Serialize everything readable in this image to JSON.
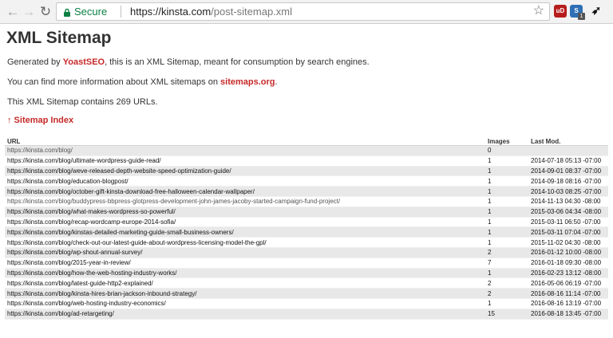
{
  "browser": {
    "secure_label": "Secure",
    "url_host": "https://kinsta.com",
    "url_path": "/post-sitemap.xml",
    "extension_badge": "1",
    "ublock_label": "uD"
  },
  "page": {
    "title": "XML Sitemap",
    "intro_prefix": "Generated by ",
    "intro_link": "YoastSEO",
    "intro_suffix": ", this is an XML Sitemap, meant for consumption by search engines.",
    "more_prefix": "You can find more information about XML sitemaps on ",
    "more_link": "sitemaps.org",
    "more_suffix": ".",
    "count_text": "This XML Sitemap contains 269 URLs.",
    "index_link": "↑ Sitemap Index"
  },
  "table": {
    "headers": [
      "URL",
      "Images",
      "Last Mod."
    ],
    "rows": [
      [
        "https://kinsta.com/blog/",
        "0",
        ""
      ],
      [
        "https://kinsta.com/blog/ultimate-wordpress-guide-read/",
        "1",
        "2014-07-18 05:13 -07:00"
      ],
      [
        "https://kinsta.com/blog/weve-released-depth-website-speed-optimization-guide/",
        "1",
        "2014-09-01 08:37 -07:00"
      ],
      [
        "https://kinsta.com/blog/education-blogpost/",
        "1",
        "2014-09-18 08:16 -07:00"
      ],
      [
        "https://kinsta.com/blog/october-gift-kinsta-download-free-halloween-calendar-wallpaper/",
        "1",
        "2014-10-03 08:25 -07:00"
      ],
      [
        "https://kinsta.com/blog/buddypress-bbpress-glotpress-development-john-james-jacoby-started-campaign-fund-project/",
        "1",
        "2014-11-13 04:30 -08:00"
      ],
      [
        "https://kinsta.com/blog/what-makes-wordpress-so-powerful/",
        "1",
        "2015-03-06 04:34 -08:00"
      ],
      [
        "https://kinsta.com/blog/recap-wordcamp-europe-2014-sofia/",
        "1",
        "2015-03-11 06:50 -07:00"
      ],
      [
        "https://kinsta.com/blog/kinstas-detailed-marketing-guide-small-business-owners/",
        "1",
        "2015-03-11 07:04 -07:00"
      ],
      [
        "https://kinsta.com/blog/check-out-our-latest-guide-about-wordpress-licensing-model-the-gpl/",
        "1",
        "2015-11-02 04:30 -08:00"
      ],
      [
        "https://kinsta.com/blog/wp-shout-annual-survey/",
        "2",
        "2016-01-12 10:00 -08:00"
      ],
      [
        "https://kinsta.com/blog/2015-year-in-review/",
        "7",
        "2016-01-18 09:30 -08:00"
      ],
      [
        "https://kinsta.com/blog/how-the-web-hosting-industry-works/",
        "1",
        "2016-02-23 13:12 -08:00"
      ],
      [
        "https://kinsta.com/blog/latest-guide-http2-explained/",
        "2",
        "2016-05-06 06:19 -07:00"
      ],
      [
        "https://kinsta.com/blog/kinsta-hires-brian-jackson-inbound-strategy/",
        "2",
        "2016-08-16 11:14 -07:00"
      ],
      [
        "https://kinsta.com/blog/web-hosting-industry-economics/",
        "1",
        "2016-08-16 13:19 -07:00"
      ],
      [
        "https://kinsta.com/blog/ad-retargeting/",
        "15",
        "2016-08-18 13:45 -07:00"
      ]
    ]
  }
}
